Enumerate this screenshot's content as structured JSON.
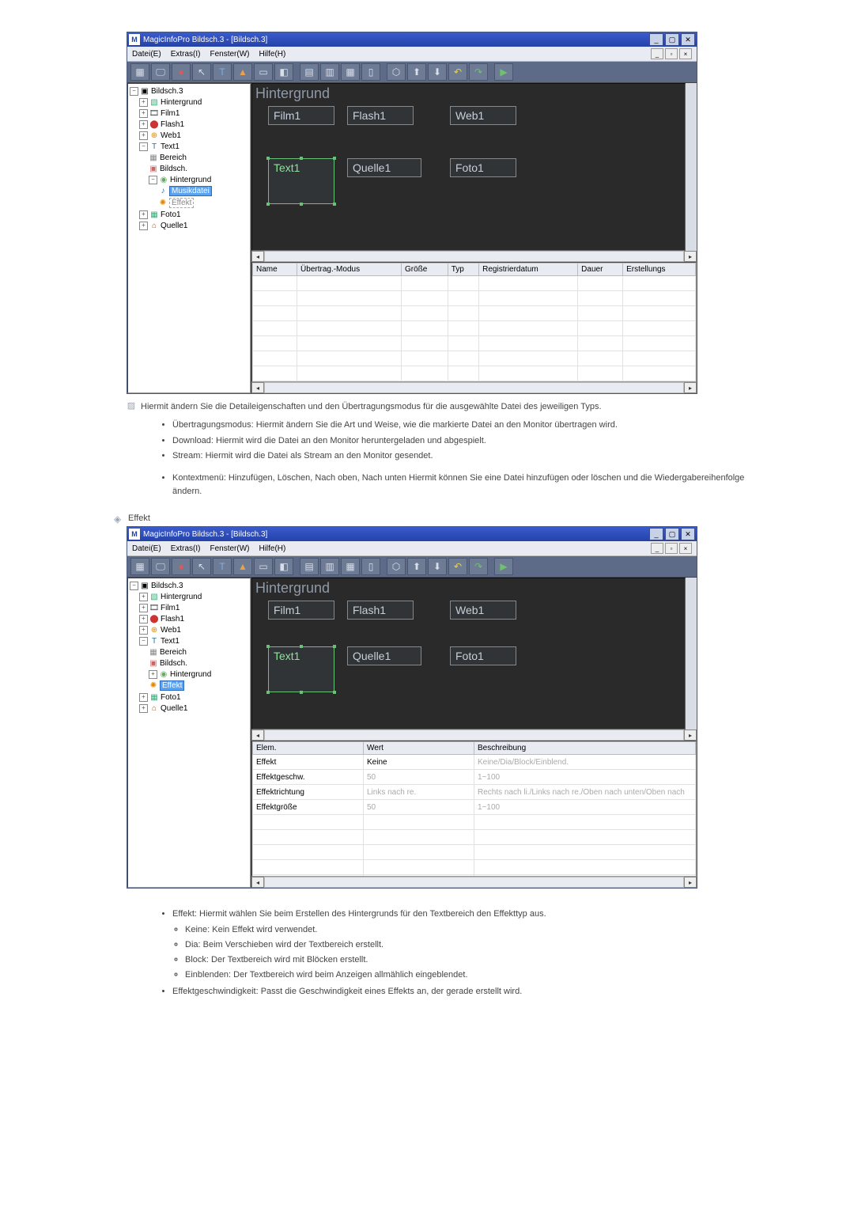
{
  "app": {
    "title": "MagicInfoPro Bildsch.3 - [Bildsch.3]",
    "menus": {
      "file": "Datei(E)",
      "extras": "Extras(I)",
      "window": "Fenster(W)",
      "help": "Hilfe(H)"
    }
  },
  "tree": {
    "root": "Bildsch.3",
    "items": {
      "hintergrund": "Hintergrund",
      "film1": "Film1",
      "flash1": "Flash1",
      "web1": "Web1",
      "text1": "Text1",
      "bereich": "Bereich",
      "bildsch": "Bildsch.",
      "hintergrund2": "Hintergrund",
      "musikdatei": "Musikdatei",
      "effekt": "Effekt",
      "foto1": "Foto1",
      "quelle1": "Quelle1"
    }
  },
  "canvas": {
    "bg": "Hintergrund",
    "film1": "Film1",
    "flash1": "Flash1",
    "web1": "Web1",
    "text1": "Text1",
    "quelle1": "Quelle1",
    "foto1": "Foto1"
  },
  "grid1": {
    "cols": {
      "name": "Name",
      "mode": "Übertrag.-Modus",
      "size": "Größe",
      "type": "Typ",
      "regdate": "Registrierdatum",
      "dur": "Dauer",
      "create": "Erstellungs"
    }
  },
  "grid2": {
    "cols": {
      "elem": "Elem.",
      "wert": "Wert",
      "beschr": "Beschreibung"
    },
    "rows": [
      {
        "elem": "Effekt",
        "wert": "Keine",
        "beschr": "Keine/Dia/Block/Einblend."
      },
      {
        "elem": "Effektgeschw.",
        "wert": "50",
        "beschr": "1~100"
      },
      {
        "elem": "Effektrichtung",
        "wert": "Links nach re.",
        "beschr": "Rechts nach li./Links nach re./Oben nach unten/Oben nach"
      },
      {
        "elem": "Effektgröße",
        "wert": "50",
        "beschr": "1~100"
      }
    ]
  },
  "doc": {
    "intro": "Hiermit ändern Sie die Detaileigenschaften und den Übertragungsmodus für die ausgewählte Datei des jeweiligen Typs.",
    "b1": "Übertragungsmodus: Hiermit ändern Sie die Art und Weise, wie die markierte Datei an den Monitor übertragen wird.",
    "b2": "Download: Hiermit wird die Datei an den Monitor heruntergeladen und abgespielt.",
    "b3": "Stream: Hiermit wird die Datei als Stream an den Monitor gesendet.",
    "b4": "Kontextmenü: Hinzufügen, Löschen, Nach oben, Nach unten Hiermit können Sie eine Datei hinzufügen oder löschen und die Wiedergabereihenfolge ändern.",
    "effektTitle": "Effekt",
    "e1": "Effekt: Hiermit wählen Sie beim Erstellen des Hintergrunds für den Textbereich den Effekttyp aus.",
    "e1a": "Keine: Kein Effekt wird verwendet.",
    "e1b": "Dia: Beim Verschieben wird der Textbereich erstellt.",
    "e1c": "Block: Der Textbereich wird mit Blöcken erstellt.",
    "e1d": "Einblenden: Der Textbereich wird beim Anzeigen allmählich eingeblendet.",
    "e2": "Effektgeschwindigkeit: Passt die Geschwindigkeit eines Effekts an, der gerade erstellt wird."
  }
}
